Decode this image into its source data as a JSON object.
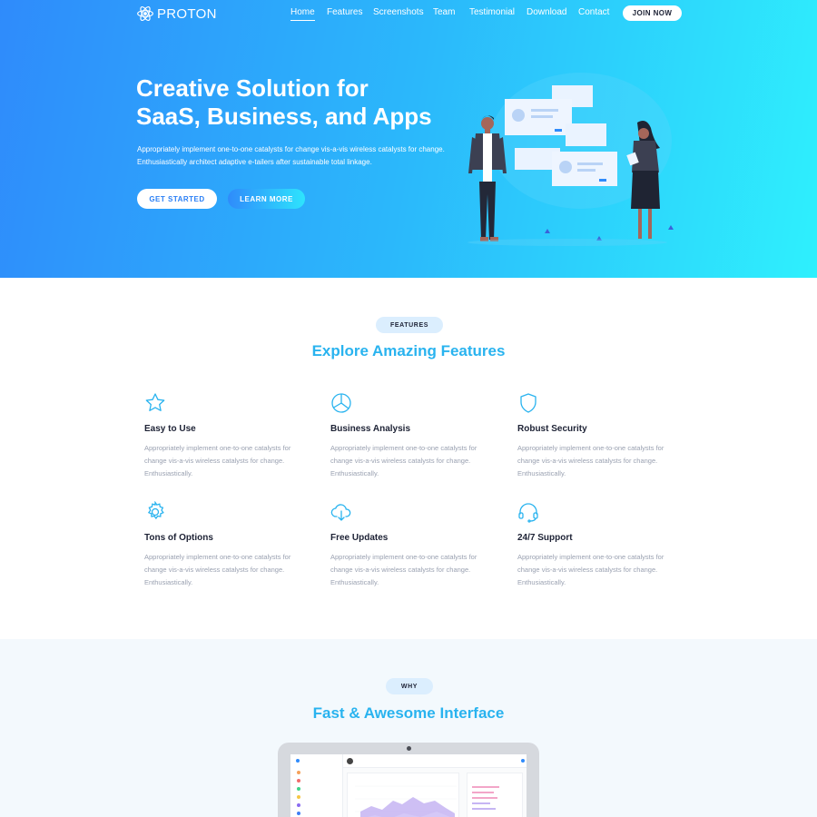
{
  "brand": {
    "name": "PROTON"
  },
  "nav": {
    "items": [
      {
        "label": "Home",
        "active": true
      },
      {
        "label": "Features",
        "active": false
      },
      {
        "label": "Screenshots",
        "active": false
      },
      {
        "label": "Team",
        "active": false
      },
      {
        "label": "Testimonial",
        "active": false
      },
      {
        "label": "Download",
        "active": false
      },
      {
        "label": "Contact",
        "active": false
      }
    ],
    "cta_label": "JOIN NOW"
  },
  "hero": {
    "title_line1": "Creative Solution for",
    "title_line2": "SaaS, Business, and Apps",
    "subtitle_line1": "Appropriately implement one-to-one catalysts for change vis-a-vis wireless catalysts for change.",
    "subtitle_line2": "Enthusiastically architect adaptive e-tailers after sustainable total linkage.",
    "primary_button": "GET STARTED",
    "secondary_button": "LEARN MORE"
  },
  "features": {
    "pill": "FEATURES",
    "title": "Explore Amazing Features",
    "items": [
      {
        "icon": "star-icon",
        "title": "Easy to Use",
        "text": "Appropriately implement one-to-one catalysts for change vis-a-vis wireless catalysts for change. Enthusiastically."
      },
      {
        "icon": "pie-chart-icon",
        "title": "Business Analysis",
        "text": "Appropriately implement one-to-one catalysts for change vis-a-vis wireless catalysts for change. Enthusiastically."
      },
      {
        "icon": "shield-icon",
        "title": "Robust Security",
        "text": "Appropriately implement one-to-one catalysts for change vis-a-vis wireless catalysts for change. Enthusiastically."
      },
      {
        "icon": "gear-icon",
        "title": "Tons of Options",
        "text": "Appropriately implement one-to-one catalysts for change vis-a-vis wireless catalysts for change. Enthusiastically."
      },
      {
        "icon": "cloud-download-icon",
        "title": "Free Updates",
        "text": "Appropriately implement one-to-one catalysts for change vis-a-vis wireless catalysts for change. Enthusiastically."
      },
      {
        "icon": "headset-icon",
        "title": "24/7 Support",
        "text": "Appropriately implement one-to-one catalysts for change vis-a-vis wireless catalysts for change. Enthusiastically."
      }
    ]
  },
  "why": {
    "pill": "WHY",
    "title": "Fast & Awesome Interface"
  },
  "colors": {
    "hero_gradient_start": "#2f8bfb",
    "hero_gradient_end": "#2ef0fd",
    "accent": "#29b3ef",
    "pill_bg": "#dbeefe",
    "muted_text": "#9aa1b1"
  }
}
